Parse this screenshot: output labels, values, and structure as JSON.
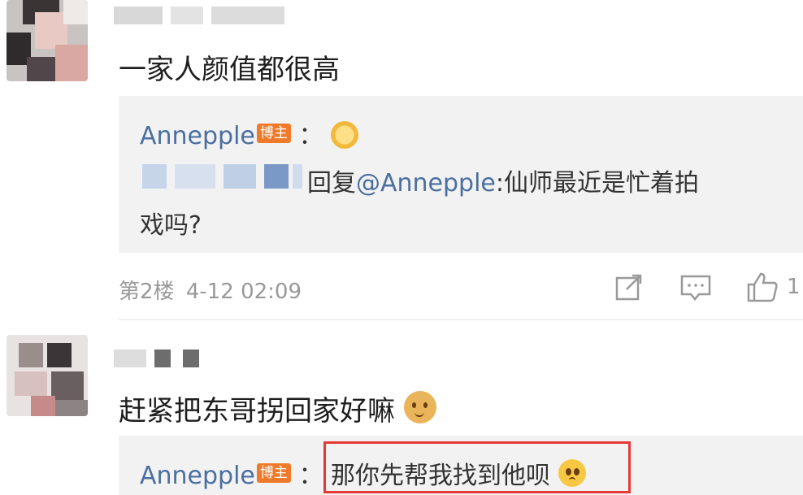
{
  "comments": [
    {
      "text": "一家人颜值都很高",
      "reply": {
        "author": "Annepple",
        "badge": "博主",
        "separator": "：",
        "emoji": "sun-emoji",
        "quoted_reply_word": "回复",
        "quoted_mention": "@Annepple",
        "quoted_text_line1": ":仙师最近是忙着拍",
        "quoted_text_line2": "戏吗?"
      },
      "floor": "第2楼",
      "time": "4-12 02:09",
      "like_count": "1"
    },
    {
      "text": "赶紧把东哥拐回家好嘛",
      "emoji": "doge-emoji",
      "reply": {
        "author": "Annepple",
        "badge": "博主",
        "separator": "：",
        "text": "那你先帮我找到他呗",
        "emoji": "pleading-emoji"
      }
    }
  ],
  "icons": [
    "share-icon",
    "comment-icon",
    "like-icon"
  ],
  "colors": {
    "link": "#4a6fa0",
    "badge": "#f07a2b",
    "highlight": "#e53935"
  }
}
